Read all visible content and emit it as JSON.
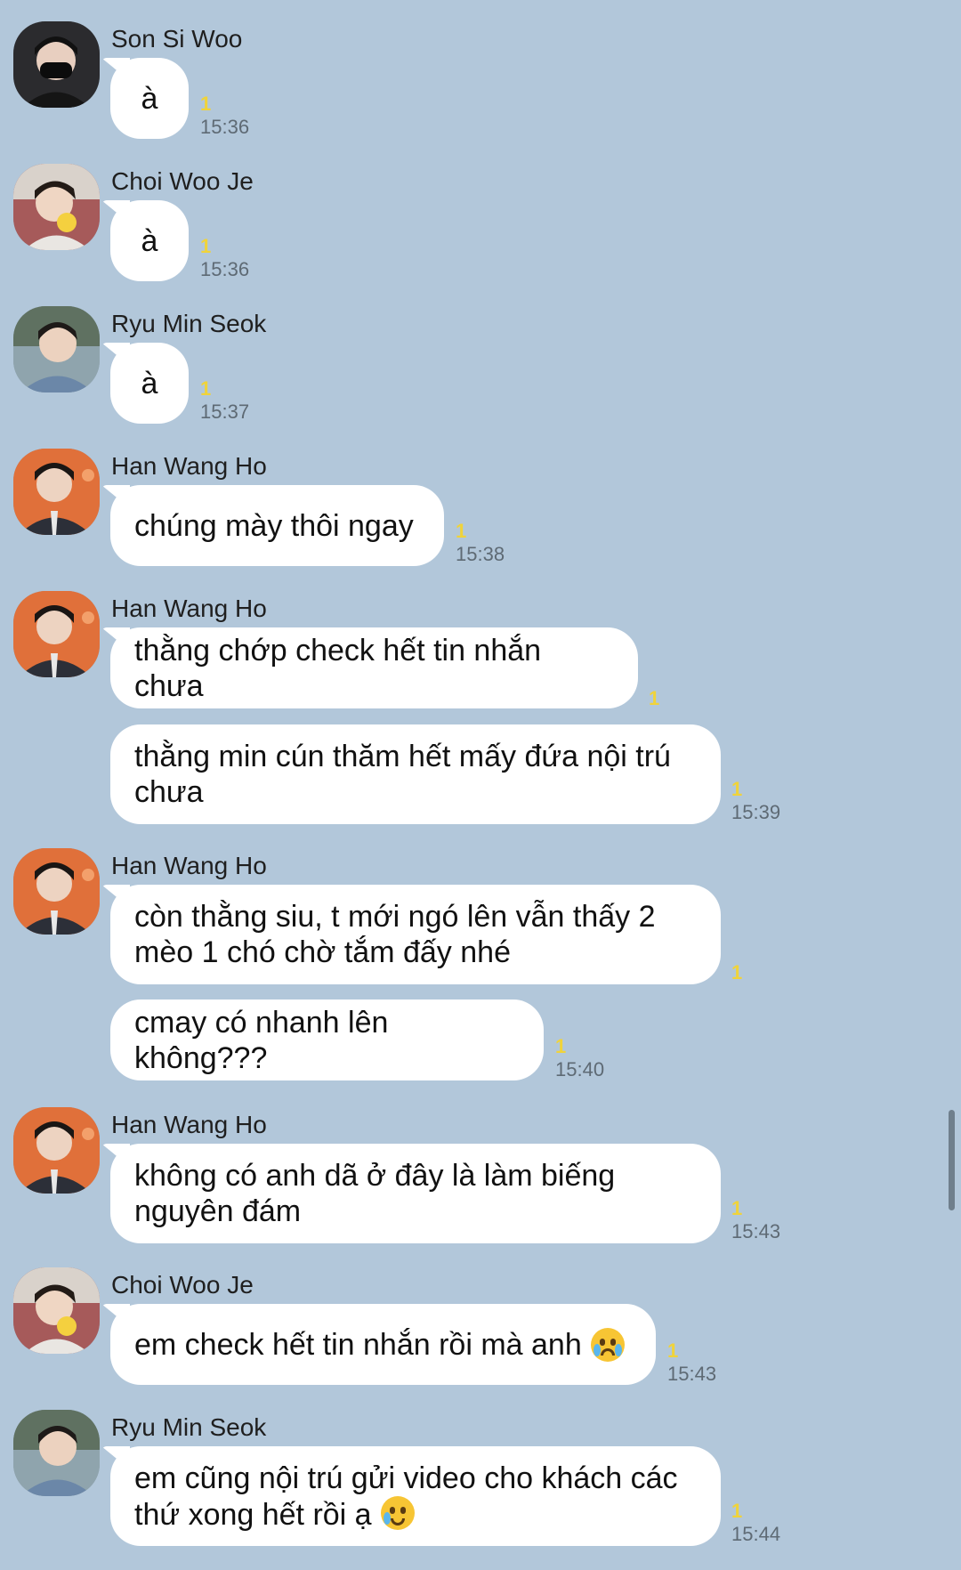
{
  "messages_groups": [
    {
      "sender": "Son Si Woo",
      "avatar": "avatar-son",
      "bubbles": [
        {
          "text": "à",
          "unread": "1",
          "time": "15:36"
        }
      ]
    },
    {
      "sender": "Choi Woo Je",
      "avatar": "avatar-choi",
      "bubbles": [
        {
          "text": "à",
          "unread": "1",
          "time": "15:36"
        }
      ]
    },
    {
      "sender": "Ryu Min Seok",
      "avatar": "avatar-ryu",
      "bubbles": [
        {
          "text": "à",
          "unread": "1",
          "time": "15:37"
        }
      ]
    },
    {
      "sender": "Han Wang Ho",
      "avatar": "avatar-han",
      "bubbles": [
        {
          "text": "chúng mày thôi ngay",
          "unread": "1",
          "time": "15:38"
        }
      ]
    },
    {
      "sender": "Han Wang Ho",
      "avatar": "avatar-han",
      "bubbles": [
        {
          "text": "thằng chớp check hết tin nhắn chưa",
          "unread": "1",
          "time": ""
        },
        {
          "text": "thằng min cún thăm hết mấy đứa nội trú chưa",
          "unread": "1",
          "time": "15:39"
        }
      ]
    },
    {
      "sender": "Han Wang Ho",
      "avatar": "avatar-han",
      "bubbles": [
        {
          "text": "còn thằng siu, t mới ngó lên vẫn thấy 2 mèo 1 chó chờ tắm đấy nhé",
          "unread": "1",
          "time": ""
        },
        {
          "text": "cmay có nhanh lên không???",
          "unread": "1",
          "time": "15:40"
        }
      ]
    },
    {
      "sender": "Han Wang Ho",
      "avatar": "avatar-han",
      "bubbles": [
        {
          "text": "không có anh dã ở đây là làm biếng nguyên đám",
          "unread": "1",
          "time": "15:43"
        }
      ]
    },
    {
      "sender": "Choi Woo Je",
      "avatar": "avatar-choi",
      "bubbles": [
        {
          "text": "em check hết tin nhắn rồi mà anh",
          "emoji": "loudly-crying-face",
          "unread": "1",
          "time": "15:43"
        }
      ]
    },
    {
      "sender": "Ryu Min Seok",
      "avatar": "avatar-ryu",
      "bubbles": [
        {
          "text": "em cũng nội trú gửi video cho khách các thứ xong hết rồi ạ",
          "emoji": "face-holding-back-tears",
          "unread": "1",
          "time": "15:44"
        }
      ]
    }
  ],
  "colors": {
    "background": "#b2c7da",
    "bubble": "#ffffff",
    "unread": "#f0d33a",
    "time": "#5e6a74"
  }
}
